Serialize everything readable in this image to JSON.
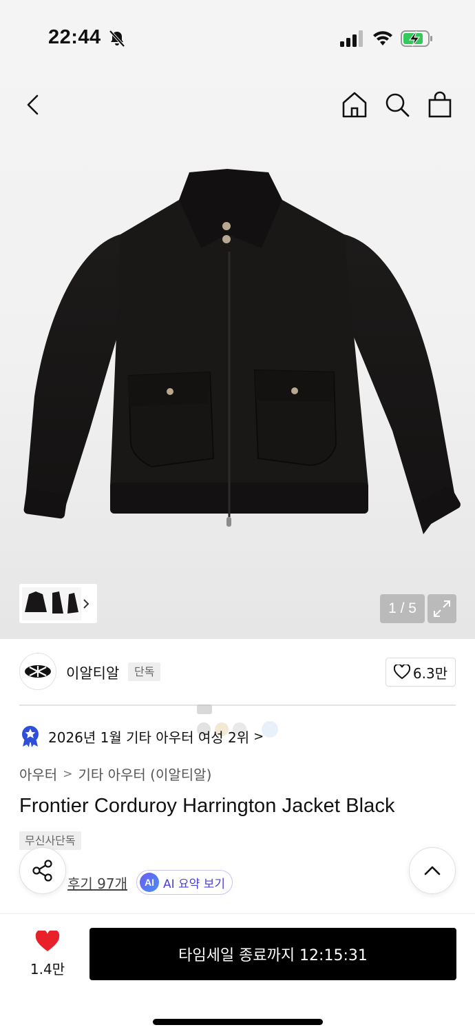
{
  "status_bar": {
    "time": "22:44",
    "icons": [
      "bell-off-icon",
      "signal-icon",
      "wifi-icon",
      "battery-charging-icon"
    ]
  },
  "header": {
    "icons": [
      "back-icon",
      "home-icon",
      "search-icon",
      "shopping-bag-icon"
    ]
  },
  "gallery": {
    "counter": "1 / 5",
    "icons": [
      "chevron-right-icon",
      "expand-icon"
    ]
  },
  "brand": {
    "name": "이알티알",
    "badge": "단독",
    "likes": "6.3만"
  },
  "ranking": {
    "text": "2026년 1월 기타 아우터 여성 2위",
    "arrow": ">"
  },
  "breadcrumb": {
    "category": "아우터",
    "separator": ">",
    "subcategory": "기타 아우터 (이알티알)"
  },
  "product": {
    "title": "Frontier Corduroy Harrington Jacket Black",
    "tag": "무신사단독",
    "reviews": "후기 97개",
    "ai_icon_text": "AI",
    "ai_button": "AI 요약 보기"
  },
  "bottom_bar": {
    "wish_count": "1.4만",
    "buy_button": "타임세일 종료까지 12:15:31"
  },
  "colors": {
    "accent_red": "#e8202a",
    "ai_purple": "#4a3fd6",
    "badge_blue": "#2f4fd9",
    "button_black": "#000000"
  }
}
